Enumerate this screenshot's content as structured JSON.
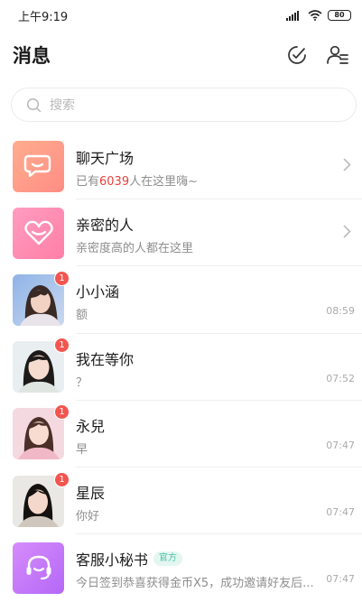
{
  "status_bar": {
    "time": "上午9:19",
    "battery": "80"
  },
  "header": {
    "title": "消息"
  },
  "search": {
    "placeholder": "搜索"
  },
  "conversations": [
    {
      "name": "聊天广场",
      "subtitle_prefix": "已有",
      "subtitle_number": "6039",
      "subtitle_suffix": "人在这里嗨~",
      "icon": "chat-bubble-icon"
    },
    {
      "name": "亲密的人",
      "subtitle": "亲密度高的人都在这里",
      "icon": "heart-icon"
    },
    {
      "name": "小小涵",
      "preview": "额",
      "time": "08:59",
      "unread": "1"
    },
    {
      "name": "我在等你",
      "preview": "？",
      "time": "07:52",
      "unread": "1"
    },
    {
      "name": "永兒",
      "preview": "早",
      "time": "07:47",
      "unread": "1"
    },
    {
      "name": "星辰",
      "preview": "你好",
      "time": "07:47",
      "unread": "1"
    },
    {
      "name": "客服小秘书",
      "badge": "官方",
      "preview": "今日签到恭喜获得金币X5，成功邀请好友后...",
      "time": "07:47",
      "icon": "headset-icon"
    }
  ],
  "colors": {
    "unread_badge": "#f2554f",
    "highlight_number": "#e8413e",
    "official_badge": "#4cc1a7"
  }
}
